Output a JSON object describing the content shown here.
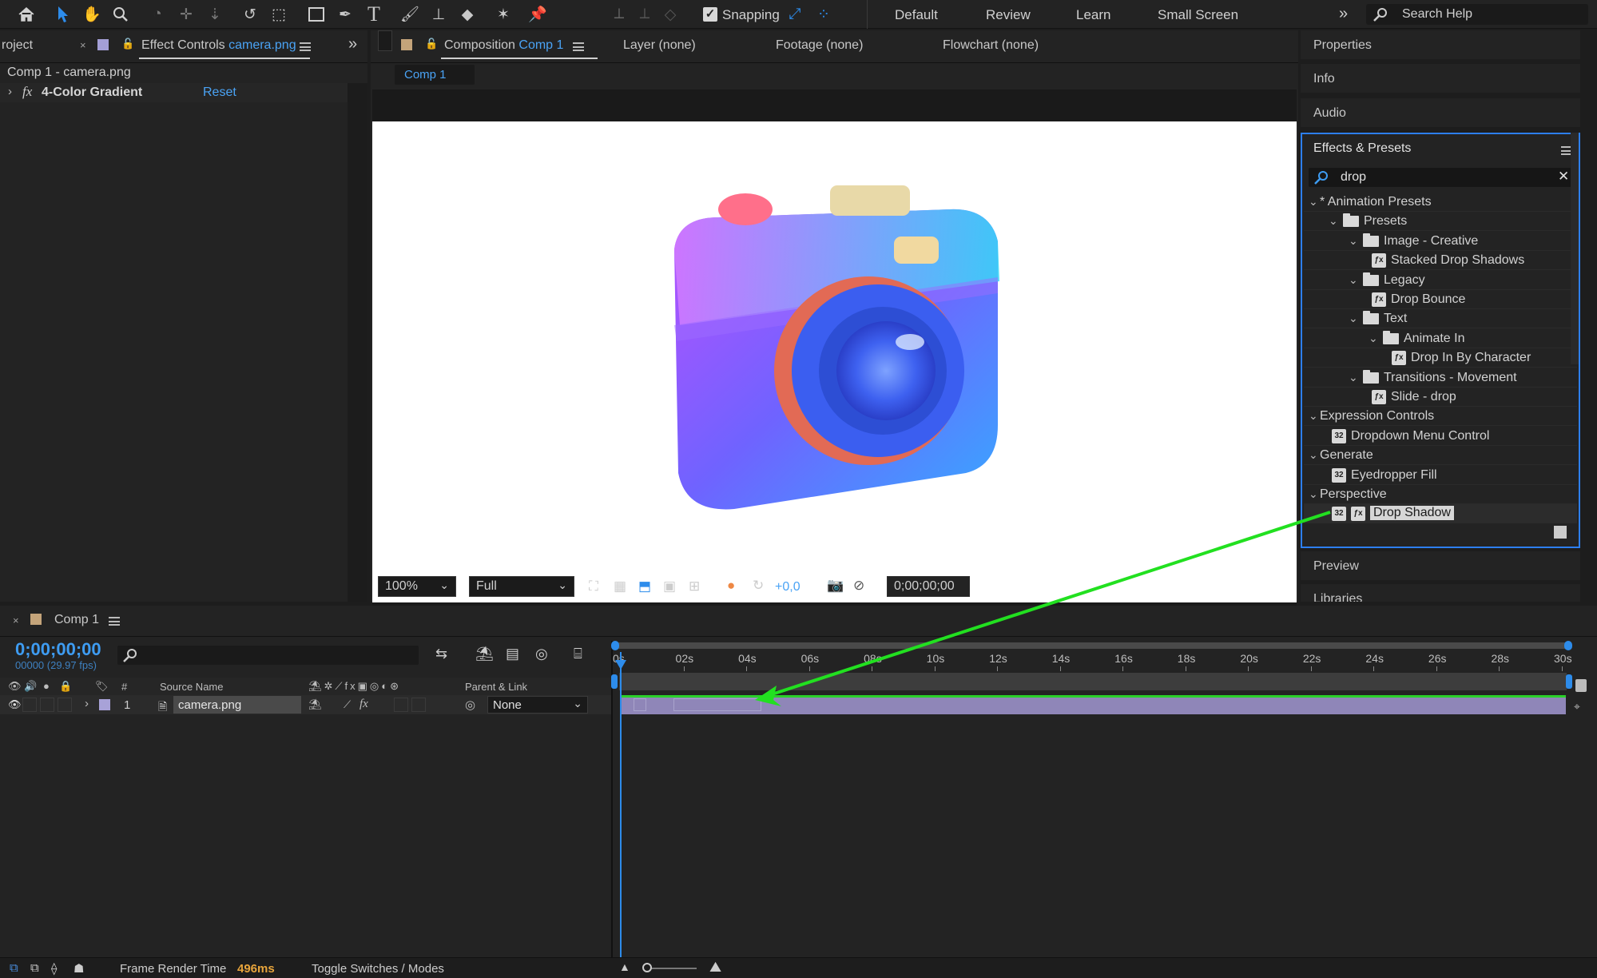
{
  "toolbar": {
    "snapping_label": "Snapping",
    "workspaces": [
      "Default",
      "Review",
      "Learn",
      "Small Screen"
    ],
    "search_placeholder": "Search Help",
    "icons": [
      "home-icon",
      "selection-arrow-icon",
      "hand-icon",
      "zoom-icon",
      "orbit-icon",
      "pan-behind-icon",
      "dolly-icon",
      "rotate-icon",
      "region-icon",
      "rectangle-icon",
      "pen-icon",
      "type-icon",
      "brush-icon",
      "clone-stamp-icon",
      "eraser-icon",
      "roto-brush-icon",
      "puppet-pin-icon"
    ]
  },
  "project_panel": {
    "tab_project": "roject",
    "tab_effect_controls": "Effect Controls",
    "effect_controls_target": "camera.png",
    "path": "Comp 1 - camera.png",
    "effect_name": "4-Color Gradient",
    "reset_label": "Reset"
  },
  "comp_panel": {
    "tab_composition": "Composition",
    "comp_name": "Comp 1",
    "tab_layer": "Layer (none)",
    "tab_footage": "Footage (none)",
    "tab_flowchart": "Flowchart (none)",
    "comp_chip": "Comp 1",
    "zoom": "100%",
    "resolution": "Full",
    "exposure": "+0,0",
    "timecode": "0;00;00;00"
  },
  "right_panel": {
    "sections": [
      "Properties",
      "Info",
      "Audio"
    ],
    "effects_title": "Effects & Presets",
    "search_value": "drop",
    "tree": [
      {
        "label": "* Animation Presets",
        "kind": "group",
        "level": 0
      },
      {
        "label": "Presets",
        "kind": "folder",
        "level": 1
      },
      {
        "label": "Image - Creative",
        "kind": "folder",
        "level": 2
      },
      {
        "label": "Stacked Drop Shadows",
        "kind": "preset",
        "level": 3
      },
      {
        "label": "Legacy",
        "kind": "folder",
        "level": 2
      },
      {
        "label": "Drop Bounce",
        "kind": "preset",
        "level": 3
      },
      {
        "label": "Text",
        "kind": "folder",
        "level": 2
      },
      {
        "label": "Animate In",
        "kind": "folder",
        "level": 3
      },
      {
        "label": "Drop In By Character",
        "kind": "preset",
        "level": 4
      },
      {
        "label": "Transitions - Movement",
        "kind": "folder",
        "level": 2
      },
      {
        "label": "Slide - drop",
        "kind": "preset",
        "level": 3
      },
      {
        "label": "Expression Controls",
        "kind": "group",
        "level": 0
      },
      {
        "label": "Dropdown Menu Control",
        "kind": "effect",
        "level": 1
      },
      {
        "label": "Generate",
        "kind": "group",
        "level": 0
      },
      {
        "label": "Eyedropper Fill",
        "kind": "effect",
        "level": 1
      },
      {
        "label": "Perspective",
        "kind": "group",
        "level": 0
      },
      {
        "label": "Drop Shadow",
        "kind": "effect-selected",
        "level": 1
      }
    ],
    "preview_label": "Preview",
    "libraries_label": "Libraries"
  },
  "timeline": {
    "tab_label": "Comp 1",
    "timecode": "0;00;00;00",
    "frame_info": "00000 (29.97 fps)",
    "col_source_name": "Source Name",
    "col_parent_link": "Parent & Link",
    "col_number": "#",
    "layer_number": "1",
    "layer_name": "camera.png",
    "parent_value": "None",
    "ticks": [
      "0s",
      "02s",
      "04s",
      "06s",
      "08s",
      "10s",
      "12s",
      "14s",
      "16s",
      "18s",
      "20s",
      "22s",
      "24s",
      "26s",
      "28s",
      "30s"
    ]
  },
  "status_bar": {
    "frame_render_label": "Frame Render Time",
    "frame_render_value": "496ms",
    "toggle_label": "Toggle Switches / Modes"
  },
  "colors": {
    "accent_blue": "#2d8ceb",
    "annotation_arrow": "#22e020",
    "layer_bar": "#8f86b8",
    "layer_label": "#a8a2d8"
  }
}
